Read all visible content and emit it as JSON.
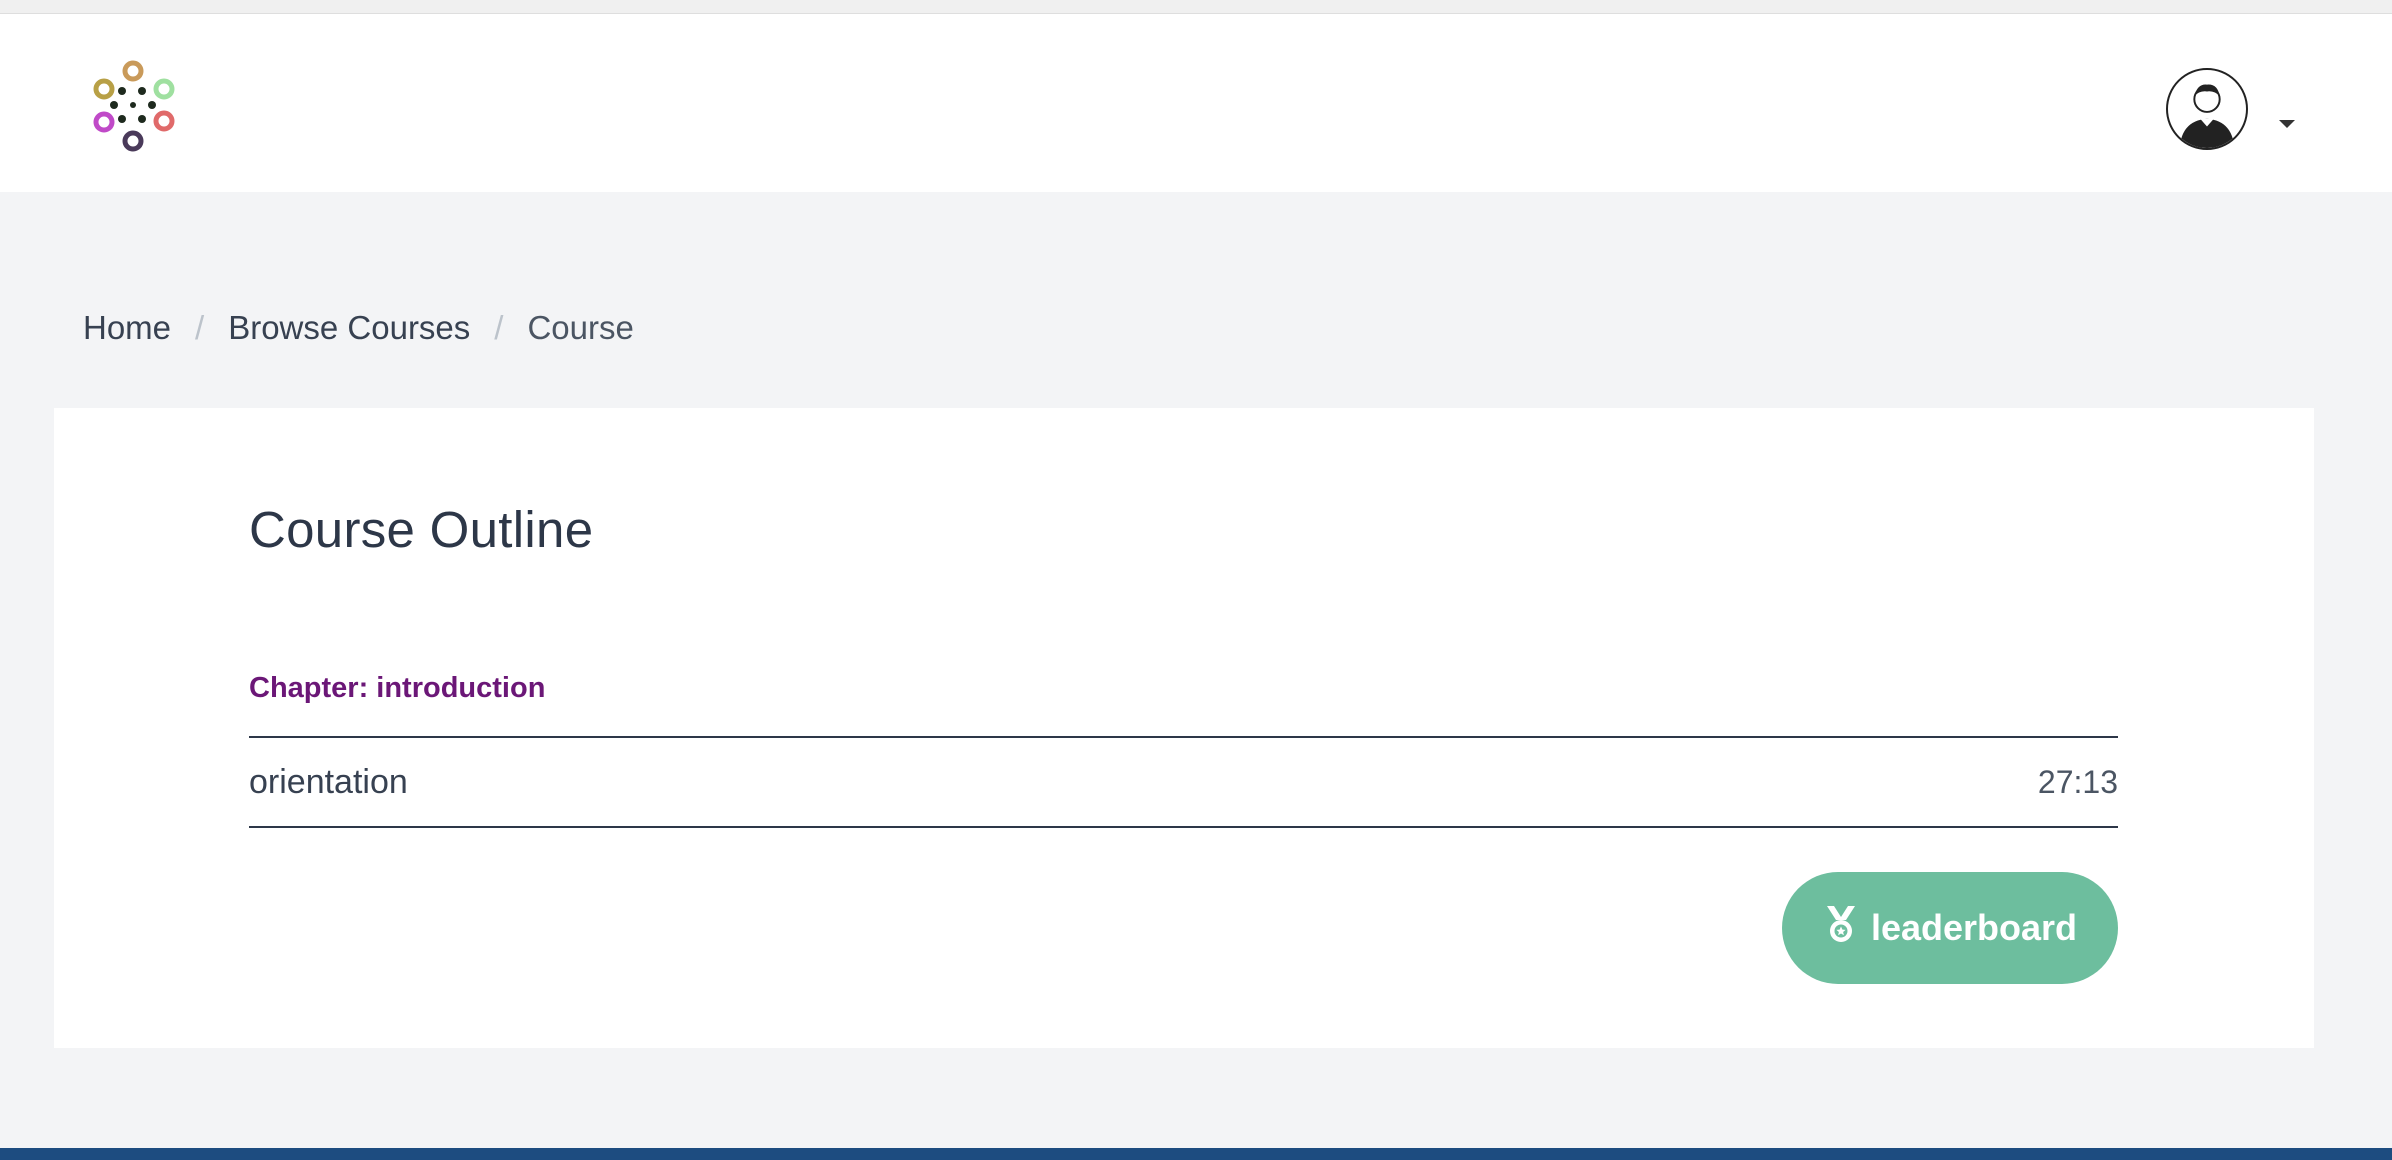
{
  "header": {
    "logo_name": "brand-logo",
    "avatar_name": "user-avatar",
    "caret_name": "chevron-down-icon"
  },
  "breadcrumb": {
    "items": [
      "Home",
      "Browse Courses",
      "Course"
    ],
    "separator": "/"
  },
  "course": {
    "title": "Course Outline",
    "chapter_label": "Chapter: introduction",
    "lessons": [
      {
        "name": "orientation",
        "duration": "27:13"
      }
    ],
    "leaderboard_label": "leaderboard",
    "leaderboard_icon": "medal-icon"
  },
  "colors": {
    "page_bg": "#f3f4f6",
    "chapter": "#6b1777",
    "button": "#6dbe9e",
    "footer": "#1d4c80"
  }
}
